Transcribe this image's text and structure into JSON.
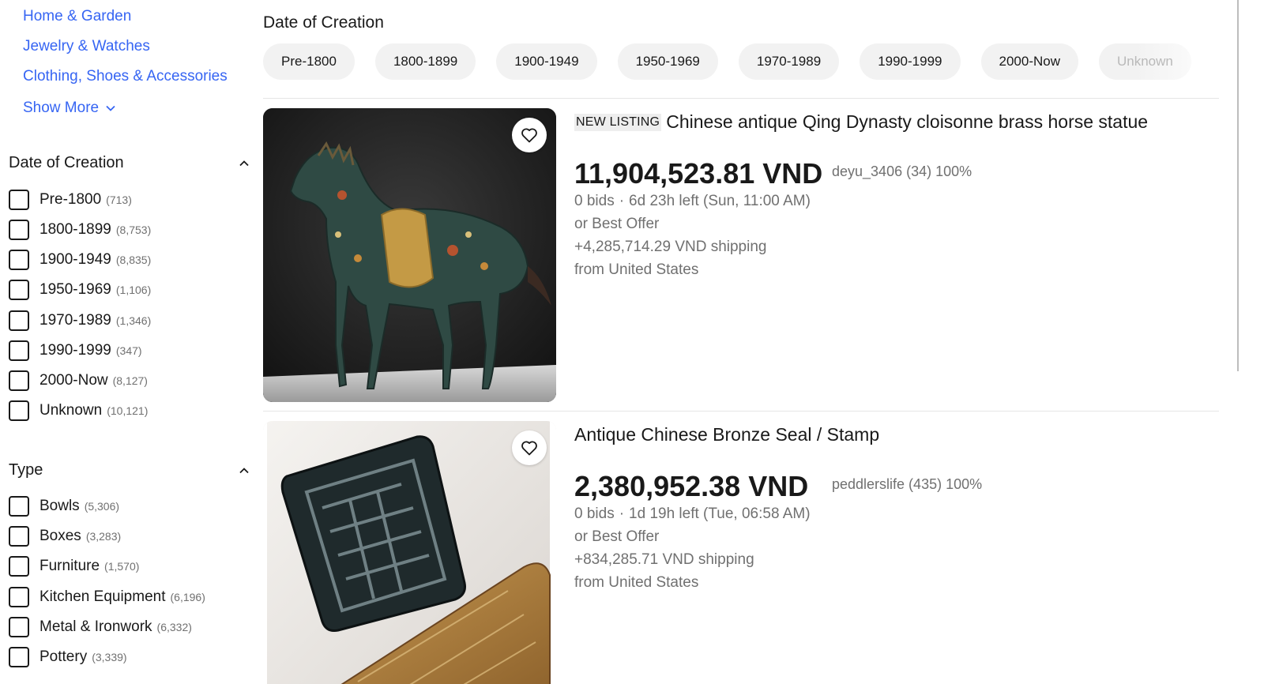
{
  "sidebar": {
    "category_links": [
      "Home & Garden",
      "Jewelry & Watches",
      "Clothing, Shoes & Accessories"
    ],
    "show_more": "Show More",
    "date_facet": {
      "title": "Date of Creation",
      "options": [
        {
          "label": "Pre-1800",
          "count": "(713)"
        },
        {
          "label": "1800-1899",
          "count": "(8,753)"
        },
        {
          "label": "1900-1949",
          "count": "(8,835)"
        },
        {
          "label": "1950-1969",
          "count": "(1,106)"
        },
        {
          "label": "1970-1989",
          "count": "(1,346)"
        },
        {
          "label": "1990-1999",
          "count": "(347)"
        },
        {
          "label": "2000-Now",
          "count": "(8,127)"
        },
        {
          "label": "Unknown",
          "count": "(10,121)"
        }
      ]
    },
    "type_facet": {
      "title": "Type",
      "options": [
        {
          "label": "Bowls",
          "count": "(5,306)"
        },
        {
          "label": "Boxes",
          "count": "(3,283)"
        },
        {
          "label": "Furniture",
          "count": "(1,570)"
        },
        {
          "label": "Kitchen Equipment",
          "count": "(6,196)"
        },
        {
          "label": "Metal & Ironwork",
          "count": "(6,332)"
        },
        {
          "label": "Pottery",
          "count": "(3,339)"
        }
      ]
    }
  },
  "main": {
    "title": "Date of Creation",
    "chips": [
      "Pre-1800",
      "1800-1899",
      "1900-1949",
      "1950-1969",
      "1970-1989",
      "1990-1999",
      "2000-Now",
      "Unknown"
    ]
  },
  "listings": [
    {
      "badge": "NEW LISTING",
      "title": "Chinese antique Qing Dynasty cloisonne brass horse statue",
      "price": "11,904,523.81 VND",
      "seller": "deyu_3406 (34) 100%",
      "bids": "0 bids",
      "time_left": "6d 23h left (Sun, 11:00 AM)",
      "offer": "or Best Offer",
      "shipping": "+4,285,714.29 VND shipping",
      "location": "from United States",
      "image_icon": "horse-statue-image"
    },
    {
      "badge": "",
      "title": "Antique Chinese Bronze Seal / Stamp",
      "price": "2,380,952.38 VND",
      "seller": "peddlerslife (435) 100%",
      "bids": "0 bids",
      "time_left": "1d 19h left (Tue, 06:58 AM)",
      "offer": "or Best Offer",
      "shipping": "+834,285.71 VND shipping",
      "location": "from United States",
      "image_icon": "bronze-seal-image"
    }
  ],
  "colors": {
    "link": "#3665f3",
    "text": "#191919",
    "muted": "#707070",
    "chip_bg": "#f2f2f2"
  }
}
